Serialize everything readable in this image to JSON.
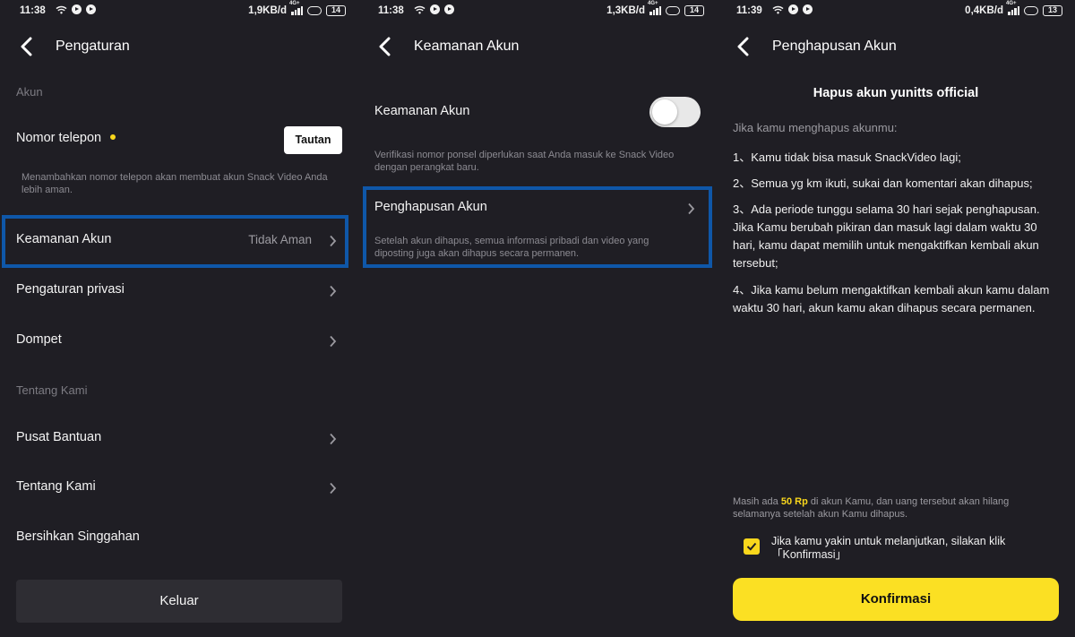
{
  "panels": [
    {
      "status": {
        "time": "11:38",
        "speed": "1,9KB/d",
        "net": "4G+",
        "battery": "14"
      },
      "title": "Pengaturan",
      "section_akun": "Akun",
      "phone": {
        "label": "Nomor telepon",
        "button": "Tautan",
        "desc": "Menambahkan nomor telepon akan membuat akun Snack Video Anda lebih aman."
      },
      "security": {
        "label": "Keamanan Akun",
        "value": "Tidak Aman"
      },
      "privacy": "Pengaturan privasi",
      "wallet": "Dompet",
      "section_about": "Tentang Kami",
      "help": "Pusat Bantuan",
      "about": "Tentang Kami",
      "clear_cache": "Bersihkan Singgahan",
      "logout": "Keluar"
    },
    {
      "status": {
        "time": "11:38",
        "speed": "1,3KB/d",
        "net": "4G+",
        "battery": "14"
      },
      "title": "Keamanan Akun",
      "security_label": "Keamanan Akun",
      "security_desc": "Verifikasi nomor ponsel diperlukan saat Anda masuk ke Snack Video dengan perangkat baru.",
      "toggle_on": false,
      "deletion_label": "Penghapusan Akun",
      "deletion_desc": "Setelah akun dihapus, semua informasi pribadi dan video yang diposting juga akan dihapus secara permanen."
    },
    {
      "status": {
        "time": "11:39",
        "speed": "0,4KB/d",
        "net": "4G+",
        "battery": "13"
      },
      "title": "Penghapusan Akun",
      "heading": "Hapus akun yunitts official",
      "intro": "Jika kamu menghapus akunmu:",
      "items": [
        "1、Kamu tidak bisa masuk SnackVideo lagi;",
        "2、Semua yg km ikuti, sukai dan komentari akan dihapus;",
        "3、Ada periode tunggu selama 30 hari sejak penghapusan. Jika Kamu berubah pikiran dan masuk lagi dalam waktu 30 hari, kamu dapat memilih untuk mengaktifkan kembali akun tersebut;",
        "4、Jika kamu belum mengaktifkan kembali akun kamu dalam waktu 30 hari, akun kamu akan dihapus secara permanen."
      ],
      "note_pre": "Masih ada",
      "note_amount": "50 Rp",
      "note_post": "di akun Kamu, dan uang tersebut akan hilang selamanya setelah akun Kamu dihapus.",
      "checkbox_checked": true,
      "confirm_text": "Jika kamu yakin untuk melanjutkan, silakan klik「Konfirmasi」",
      "confirm_button": "Konfirmasi"
    }
  ],
  "colors": {
    "background": "#1f1e24",
    "accent_yellow": "#fbe023",
    "highlight_border": "#0f57a8",
    "muted_text": "#8c8b92"
  },
  "icons": [
    "back-arrow-icon",
    "chevron-right-icon",
    "wifi-icon",
    "signal-icon",
    "battery-icon",
    "checkmark-icon"
  ]
}
